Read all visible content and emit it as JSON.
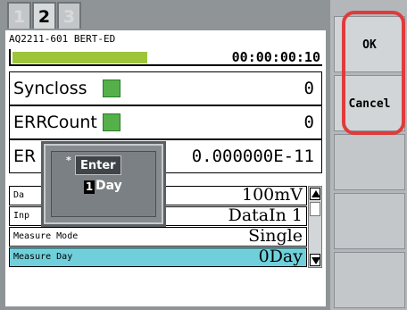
{
  "tabs": [
    {
      "label": "1",
      "active": false
    },
    {
      "label": "2",
      "active": true
    },
    {
      "label": "3",
      "active": false
    }
  ],
  "header": {
    "title": "AQ2211-601 BERT-ED",
    "timer": "00:00:00:10",
    "progress_fraction": 0.64
  },
  "status_rows": {
    "syncloss": {
      "label": "Syncloss",
      "value": "0",
      "indicator_color": "#56b04a"
    },
    "errcount": {
      "label": "ERRCount",
      "value": "0",
      "indicator_color": "#56b04a"
    },
    "err": {
      "label": "ER",
      "value": "0.000000E-11"
    }
  },
  "params": [
    {
      "label": "Da",
      "value": "100mV"
    },
    {
      "label": "Inp",
      "value": "DataIn 1"
    },
    {
      "label": "Measure Mode",
      "value": "Single"
    },
    {
      "label": "Measure Day",
      "value": "0Day",
      "selected": true
    }
  ],
  "popup": {
    "marker": "*",
    "title": "Enter",
    "digit": "1",
    "unit": "Day"
  },
  "side_buttons": {
    "ok": "OK",
    "cancel": "Cancel"
  },
  "colors": {
    "accent_highlight": "#e03b3b",
    "selected_row": "#6fd0db",
    "progress": "#9ec53a"
  }
}
